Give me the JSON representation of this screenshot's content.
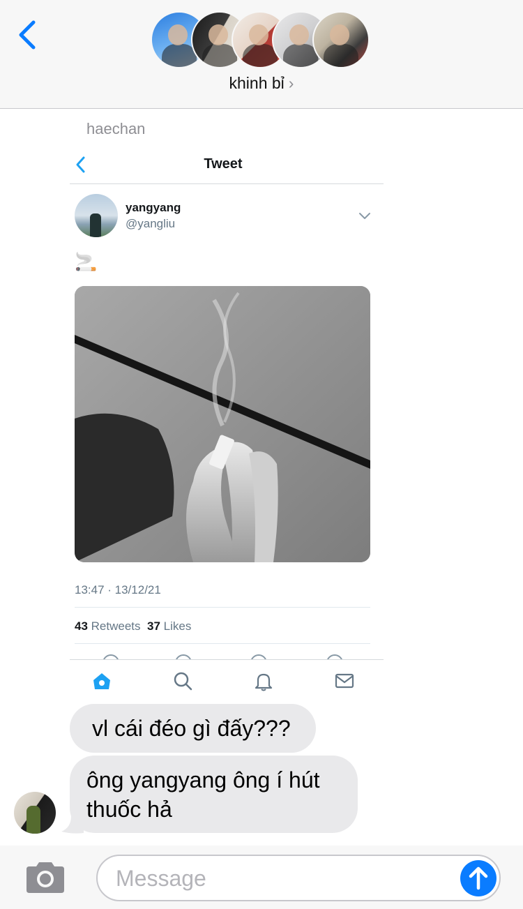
{
  "header": {
    "group_name": "khinh bỉ",
    "chevron": "›",
    "back_icon": "chevron-left-icon",
    "member_count_shown": 5
  },
  "sender_label": "haechan",
  "tweet": {
    "nav_title": "Tweet",
    "display_name": "yangyang",
    "handle": "@yangliu",
    "body_emoji": "🚬",
    "timestamp": "13:47 · 13/12/21",
    "retweets_count": "43",
    "retweets_label": "Retweets",
    "likes_count": "37",
    "likes_label": "Likes",
    "tabs": [
      "home-icon",
      "search-icon",
      "bell-icon",
      "mail-icon"
    ],
    "active_tab": "home-icon",
    "accent_color": "#1da1f2"
  },
  "messages": [
    {
      "text": "vl cái đéo gì đấy???"
    },
    {
      "text": "ông yangyang ông í hút thuốc hả"
    }
  ],
  "composer": {
    "placeholder": "Message",
    "value": ""
  },
  "colors": {
    "ios_blue": "#0a7cff",
    "bubble_gray": "#e9e9eb",
    "header_bg": "#f7f7f7"
  }
}
